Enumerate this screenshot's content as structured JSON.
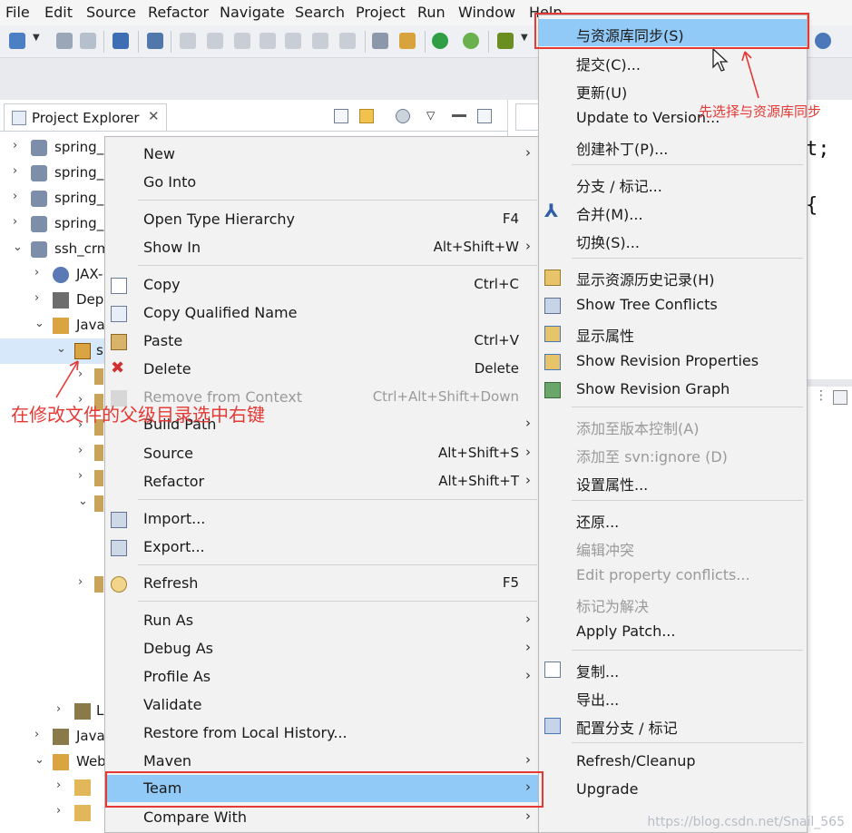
{
  "menubar": {
    "items": [
      "File",
      "Edit",
      "Source",
      "Refactor",
      "Navigate",
      "Search",
      "Project",
      "Run",
      "Window",
      "Help"
    ]
  },
  "explorer": {
    "tab_label": "Project Explorer",
    "tab_close": "✕",
    "tree": [
      {
        "arrow": "›",
        "label": "spring_"
      },
      {
        "arrow": "›",
        "label": "spring_"
      },
      {
        "arrow": "›",
        "label": "spring_"
      },
      {
        "arrow": "›",
        "label": "spring_"
      },
      {
        "arrow": "⌄",
        "label": "ssh_crm"
      },
      {
        "arrow": "›",
        "label": "JAX-"
      },
      {
        "arrow": "›",
        "label": "Dep"
      },
      {
        "arrow": "⌄",
        "label": "Java"
      },
      {
        "arrow": "⌄",
        "label": "s"
      },
      {
        "arrow": "›",
        "label": "L"
      },
      {
        "arrow": "›",
        "label": "Java"
      },
      {
        "arrow": "⌄",
        "label": "Web"
      }
    ]
  },
  "editor": {
    "code_line1": "t;",
    "code_line2": "{"
  },
  "context_menu": {
    "items": [
      {
        "label": "New",
        "shortcut": "",
        "submenu": true,
        "disabled": false
      },
      {
        "label": "Go Into",
        "shortcut": "",
        "submenu": false,
        "disabled": false
      },
      {
        "label": "Open Type Hierarchy",
        "shortcut": "F4",
        "submenu": false,
        "disabled": false
      },
      {
        "label": "Show In",
        "shortcut": "Alt+Shift+W",
        "submenu": true,
        "disabled": false
      },
      {
        "label": "Copy",
        "shortcut": "Ctrl+C",
        "submenu": false,
        "disabled": false
      },
      {
        "label": "Copy Qualified Name",
        "shortcut": "",
        "submenu": false,
        "disabled": false
      },
      {
        "label": "Paste",
        "shortcut": "Ctrl+V",
        "submenu": false,
        "disabled": false
      },
      {
        "label": "Delete",
        "shortcut": "Delete",
        "submenu": false,
        "disabled": false
      },
      {
        "label": "Remove from Context",
        "shortcut": "Ctrl+Alt+Shift+Down",
        "submenu": false,
        "disabled": true
      },
      {
        "label": "Build Path",
        "shortcut": "",
        "submenu": true,
        "disabled": false
      },
      {
        "label": "Source",
        "shortcut": "Alt+Shift+S",
        "submenu": true,
        "disabled": false
      },
      {
        "label": "Refactor",
        "shortcut": "Alt+Shift+T",
        "submenu": true,
        "disabled": false
      },
      {
        "label": "Import...",
        "shortcut": "",
        "submenu": false,
        "disabled": false
      },
      {
        "label": "Export...",
        "shortcut": "",
        "submenu": false,
        "disabled": false
      },
      {
        "label": "Refresh",
        "shortcut": "F5",
        "submenu": false,
        "disabled": false
      },
      {
        "label": "Run As",
        "shortcut": "",
        "submenu": true,
        "disabled": false
      },
      {
        "label": "Debug As",
        "shortcut": "",
        "submenu": true,
        "disabled": false
      },
      {
        "label": "Profile As",
        "shortcut": "",
        "submenu": true,
        "disabled": false
      },
      {
        "label": "Validate",
        "shortcut": "",
        "submenu": false,
        "disabled": false
      },
      {
        "label": "Restore from Local History...",
        "shortcut": "",
        "submenu": false,
        "disabled": false
      },
      {
        "label": "Maven",
        "shortcut": "",
        "submenu": true,
        "disabled": false
      },
      {
        "label": "Team",
        "shortcut": "",
        "submenu": true,
        "disabled": false
      },
      {
        "label": "Compare With",
        "shortcut": "",
        "submenu": true,
        "disabled": false
      }
    ],
    "arrow_glyph": "›"
  },
  "team_submenu": {
    "items": [
      {
        "label": "与资源库同步(S)",
        "disabled": false
      },
      {
        "label": "提交(C)...",
        "disabled": false
      },
      {
        "label": "更新(U)",
        "disabled": false
      },
      {
        "label": "Update to Version...",
        "disabled": false
      },
      {
        "label": "创建补丁(P)...",
        "disabled": false
      },
      {
        "label": "分支 / 标记...",
        "disabled": false
      },
      {
        "label": "合并(M)...",
        "disabled": false
      },
      {
        "label": "切换(S)...",
        "disabled": false
      },
      {
        "label": "显示资源历史记录(H)",
        "disabled": false
      },
      {
        "label": "Show Tree Conflicts",
        "disabled": false
      },
      {
        "label": "显示属性",
        "disabled": false
      },
      {
        "label": "Show Revision Properties",
        "disabled": false
      },
      {
        "label": "Show Revision Graph",
        "disabled": false
      },
      {
        "label": "添加至版本控制(A)",
        "disabled": true
      },
      {
        "label": "添加至 svn:ignore (D)",
        "disabled": true
      },
      {
        "label": "设置属性...",
        "disabled": false
      },
      {
        "label": "还原...",
        "disabled": false
      },
      {
        "label": "编辑冲突",
        "disabled": true
      },
      {
        "label": "Edit property conflicts...",
        "disabled": true
      },
      {
        "label": "标记为解决",
        "disabled": true
      },
      {
        "label": "Apply Patch...",
        "disabled": false
      },
      {
        "label": "复制...",
        "disabled": false
      },
      {
        "label": "导出...",
        "disabled": false
      },
      {
        "label": "配置分支 / 标记",
        "disabled": false
      },
      {
        "label": "Refresh/Cleanup",
        "disabled": false
      },
      {
        "label": "Upgrade",
        "disabled": false
      }
    ]
  },
  "annotations": {
    "left_note": "在修改文件的父级目录选中右键",
    "right_note": "先选择与资源库同步"
  },
  "watermark": "https://blog.csdn.net/Snail_565",
  "colors": {
    "highlight": "#91c9f7",
    "annotation_red": "#e53935"
  }
}
